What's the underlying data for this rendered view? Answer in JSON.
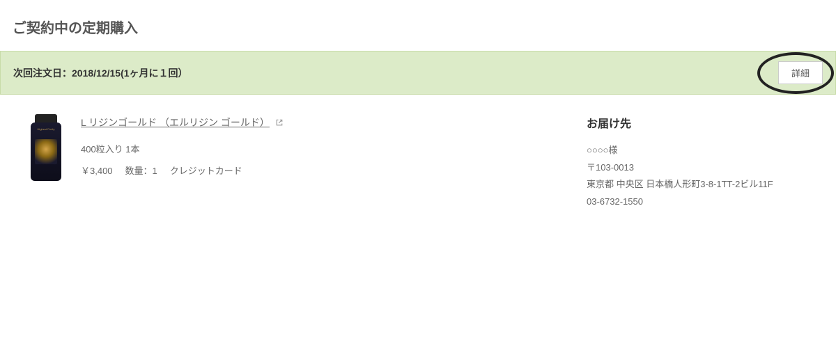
{
  "page": {
    "title": "ご契約中の定期購入"
  },
  "order_header": {
    "next_order_label": "次回注文日：2018/12/15(1ヶ月に１回）",
    "detail_button_label": "詳細"
  },
  "product": {
    "name_link": "L リジンゴールド （エルリジン ゴールド）",
    "spec_text": "400粒入り 1本",
    "price": "￥3,400",
    "quantity_label": "数量：1",
    "payment_method": "クレジットカード",
    "bottle_small_text": "Highest Purity"
  },
  "shipping": {
    "title": "お届け先",
    "recipient": "○○○○様",
    "postal_code": "〒103-0013",
    "address_line": "東京都 中央区 日本橋人形町3-8-1TT-2ビル11F",
    "phone": "03-6732-1550"
  }
}
